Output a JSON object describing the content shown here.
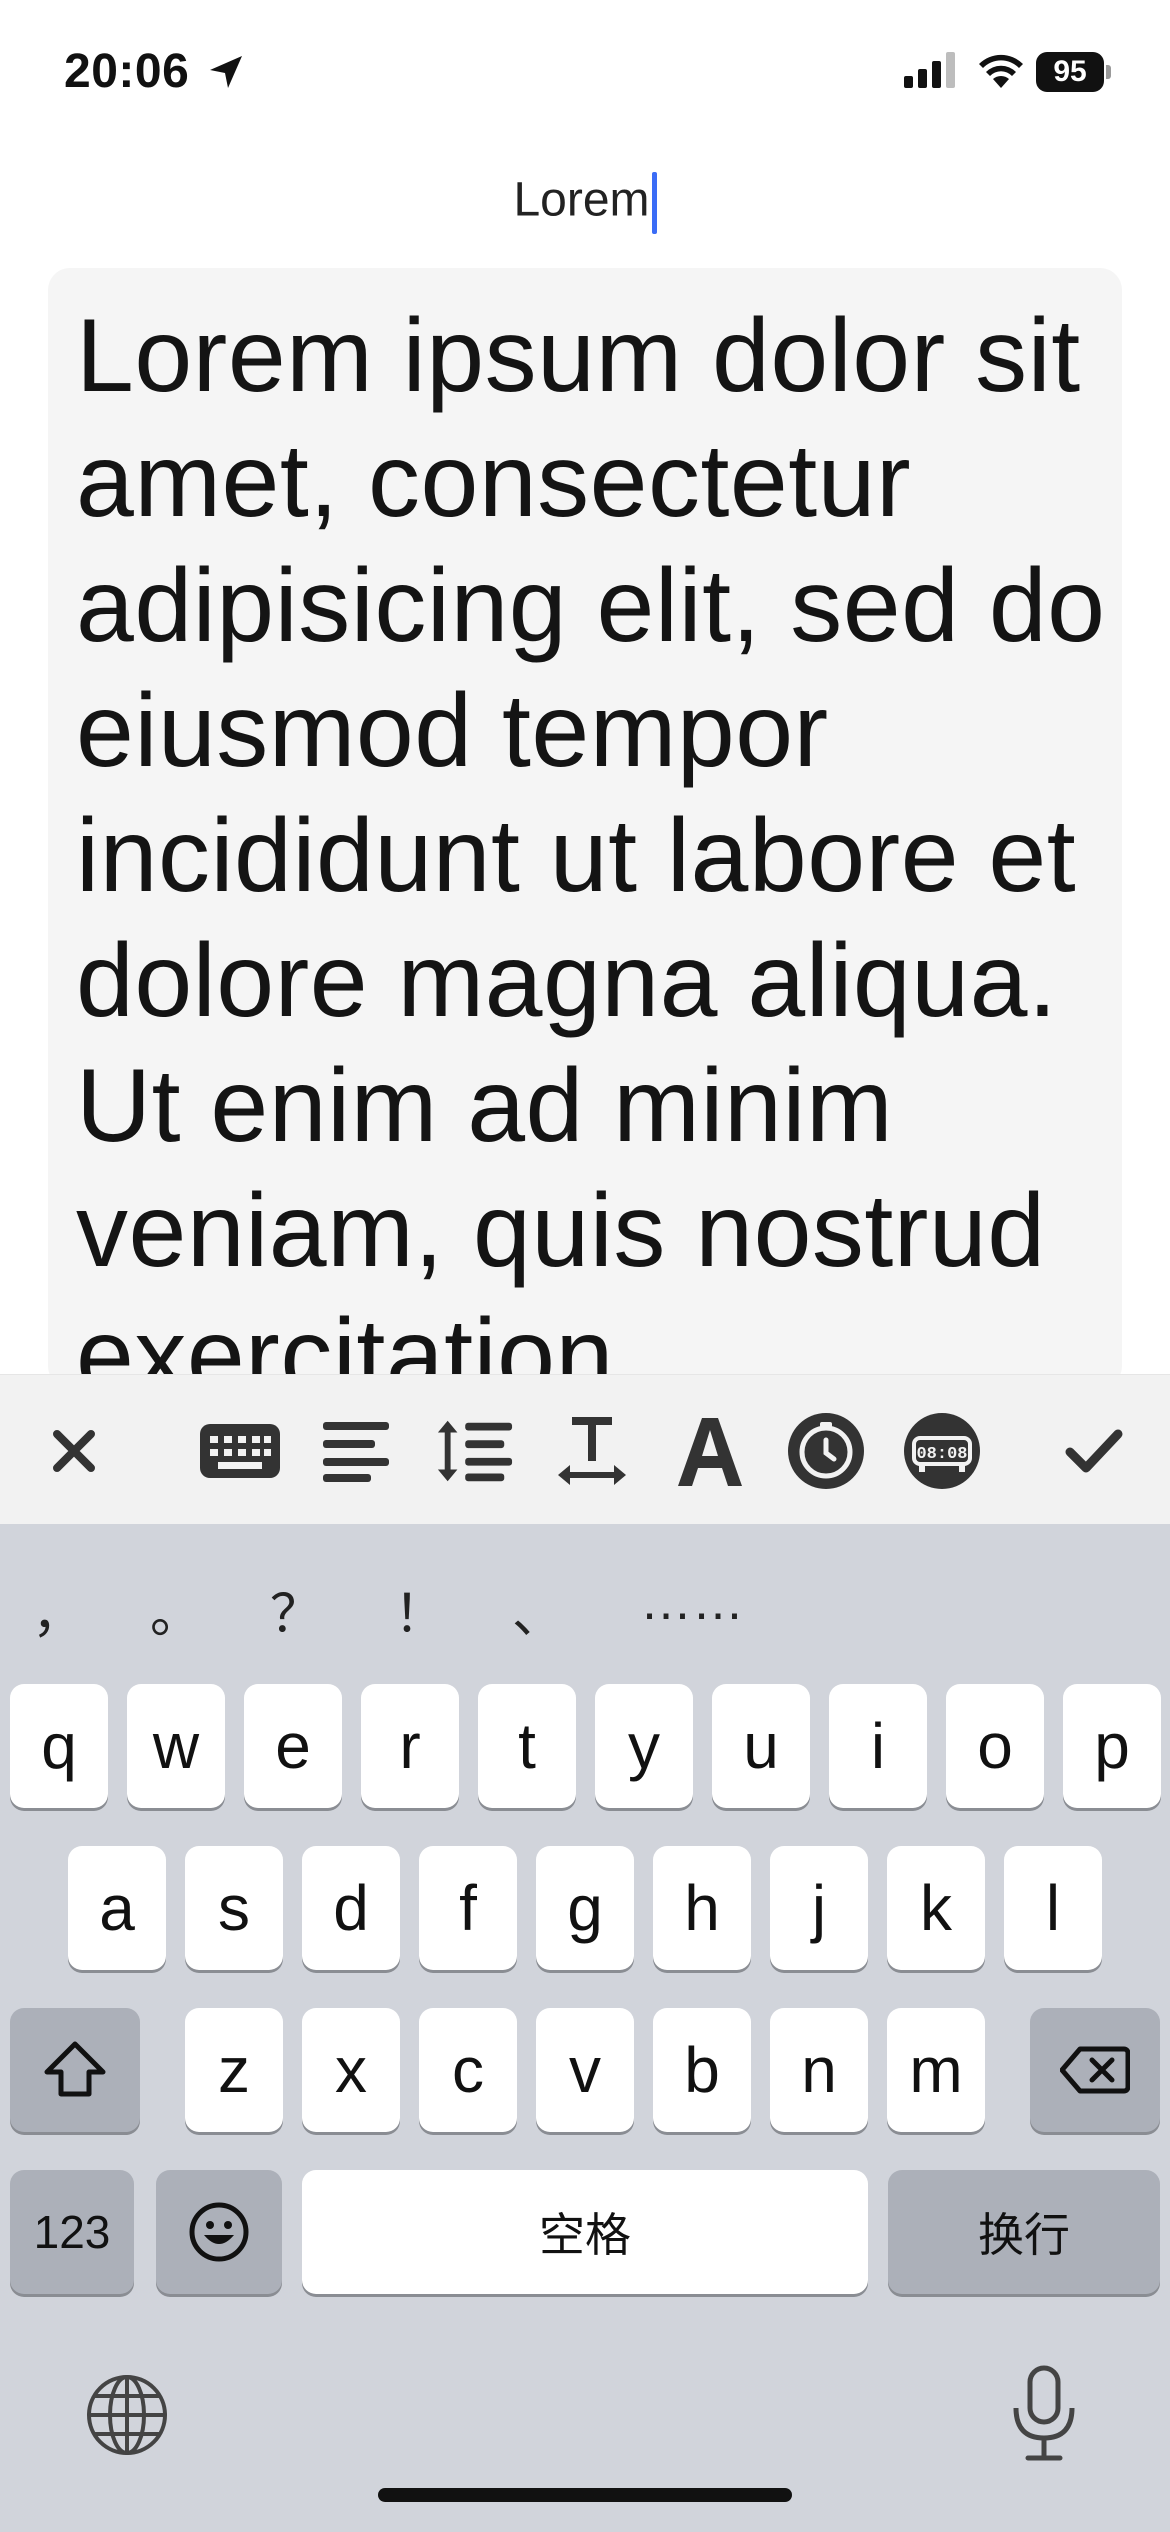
{
  "status_bar": {
    "time": "20:06",
    "battery": "95",
    "icons": [
      "location-arrow-icon",
      "signal-icon",
      "wifi-icon",
      "battery-icon"
    ]
  },
  "document": {
    "title": "Lorem",
    "body": "Lorem ipsum dolor sit amet, consectetur adipisicing elit, sed do eiusmod tempor incididunt ut labore et dolore magna aliqua. Ut enim ad minim veniam, quis nostrud exercitation"
  },
  "toolbar": {
    "items": [
      "close-icon",
      "keyboard-icon",
      "align-text-icon",
      "line-height-icon",
      "letter-spacing-icon",
      "font-icon",
      "clock-icon",
      "digital-clock-icon",
      "checkmark-icon"
    ],
    "digital_clock_label": "08:08"
  },
  "keyboard": {
    "punctuation": [
      "，",
      "。",
      "？",
      "！",
      "、",
      "……"
    ],
    "row1": [
      "q",
      "w",
      "e",
      "r",
      "t",
      "y",
      "u",
      "i",
      "o",
      "p"
    ],
    "row2": [
      "a",
      "s",
      "d",
      "f",
      "g",
      "h",
      "j",
      "k",
      "l"
    ],
    "row3": [
      "z",
      "x",
      "c",
      "v",
      "b",
      "n",
      "m"
    ],
    "numbers_label": "123",
    "space_label": "空格",
    "return_label": "换行"
  },
  "colors": {
    "caret": "#3b6cf6",
    "keyboard_bg": "#d1d4db",
    "toolbar_bg": "#f2f2f2",
    "card_bg": "#f5f5f5"
  }
}
